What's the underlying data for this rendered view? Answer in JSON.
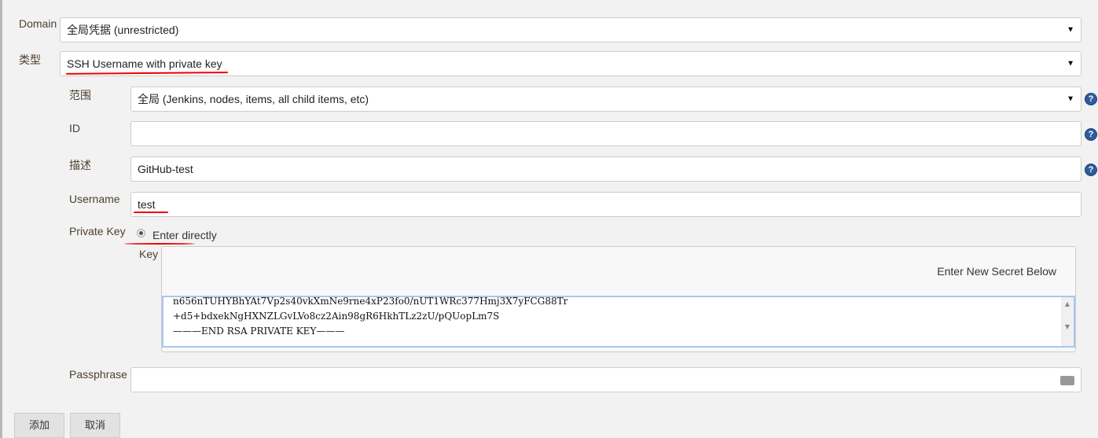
{
  "domain": {
    "label": "Domain",
    "value": "全局凭据 (unrestricted)"
  },
  "kind": {
    "label": "类型",
    "value": "SSH Username with private key"
  },
  "scope": {
    "label": "范围",
    "value": "全局 (Jenkins, nodes, items, all child items, etc)"
  },
  "id": {
    "label": "ID",
    "value": ""
  },
  "description": {
    "label": "描述",
    "value": "GitHub-test"
  },
  "username": {
    "label": "Username",
    "value": "test"
  },
  "private_key": {
    "label": "Private Key",
    "option": "Enter directly",
    "key_label": "Key",
    "secret_hint": "Enter New Secret Below",
    "lines": [
      "n656nTUHYBhYAt7Vp2s40vkXmNe9rne4xP23fo0/nUT1WRc377Hmj3X7yFCG88Tr",
      "+d5+bdxekNgHXNZLGvLVo8cz2Ain98gR6HkhTLz2zU/pQUopLm7S",
      "———END RSA PRIVATE KEY———"
    ]
  },
  "passphrase": {
    "label": "Passphrase",
    "value": ""
  },
  "buttons": {
    "add": "添加",
    "cancel": "取消"
  },
  "colors": {
    "annotation": "#e00000",
    "help": "#2f5c9c"
  }
}
